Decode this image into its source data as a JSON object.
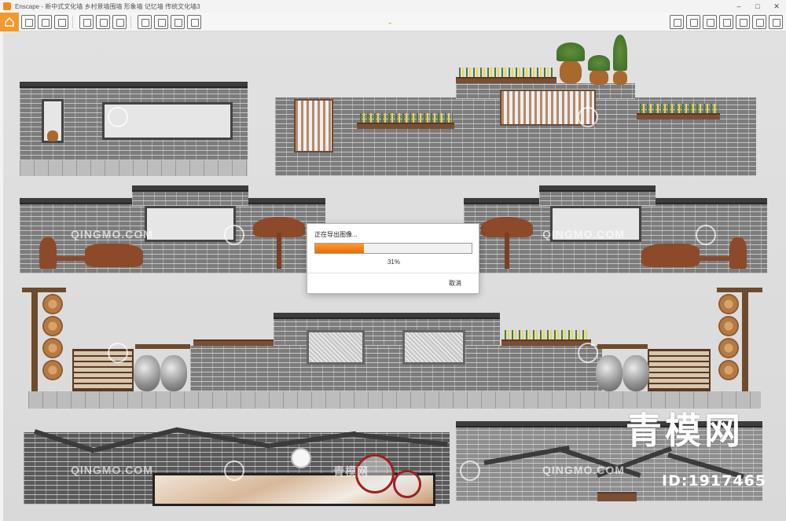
{
  "window": {
    "title": "Enscape - 新中式文化墙 乡村景墙围墙 形象墙 记忆墙 传统文化墙3",
    "minimize": "–",
    "maximize": "□",
    "close": "✕"
  },
  "toolbar": {
    "accent": "#f29a2e",
    "left_icons": [
      "home-icon",
      "link-icon",
      "sliders-icon",
      "grid-icon",
      "pin-icon",
      "building-icon",
      "camera-icon",
      "image-export-icon",
      "panorama-export-icon",
      "video-icon",
      "upload-icon"
    ],
    "right_icons": [
      "book-icon",
      "view-icon",
      "cube-icon",
      "binoculars-icon",
      "vr-icon",
      "settings-icon",
      "help-icon"
    ],
    "collapse_chevron": "⌃"
  },
  "scene": {
    "watermark_text": "QINGMO.COM",
    "watermark_text_cn": "青模网",
    "brand_mark": "青模网",
    "id_label": "ID:1917465"
  },
  "export_dialog": {
    "title": "正在导出图像...",
    "progress_percent": 31,
    "progress_label": "31%",
    "cancel_label": "取消",
    "progress_color": "#f07a10"
  }
}
